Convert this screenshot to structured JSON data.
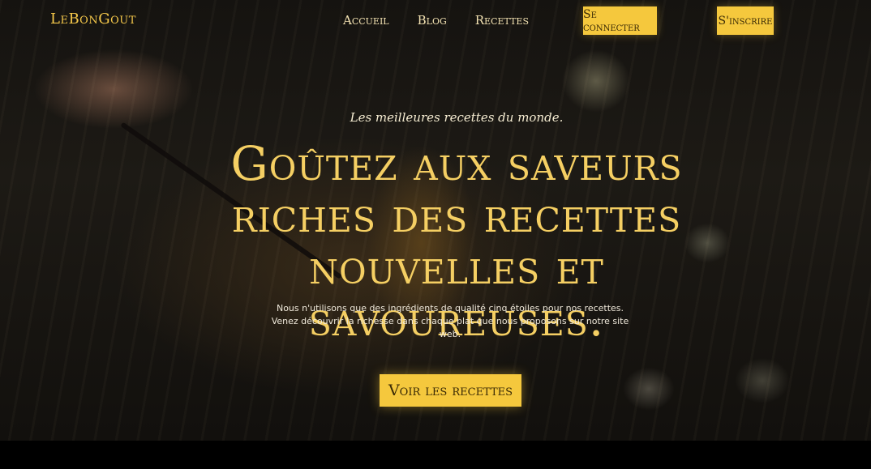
{
  "brand": {
    "name": "LeBonGout"
  },
  "nav": {
    "items": [
      {
        "label": "Accueil"
      },
      {
        "label": "Blog"
      },
      {
        "label": "Recettes"
      }
    ]
  },
  "auth": {
    "login_label": "Se connecter",
    "signup_label": "S'inscrire"
  },
  "hero": {
    "tagline": "Les meilleures recettes du monde.",
    "headline": "Goûtez aux saveurs riches des recettes nouvelles et savoureuses.",
    "subtitle": "Nous n'utilisons que des ingrédients de qualité cinq étoiles pour nos recettes. Venez découvrir la richesse dans chaque plat que nous proposons sur notre site web.",
    "cta_label": "Voir les recettes"
  },
  "colors": {
    "accent": "#f5c83d",
    "headline": "#f5cf63",
    "background": "#000000"
  }
}
